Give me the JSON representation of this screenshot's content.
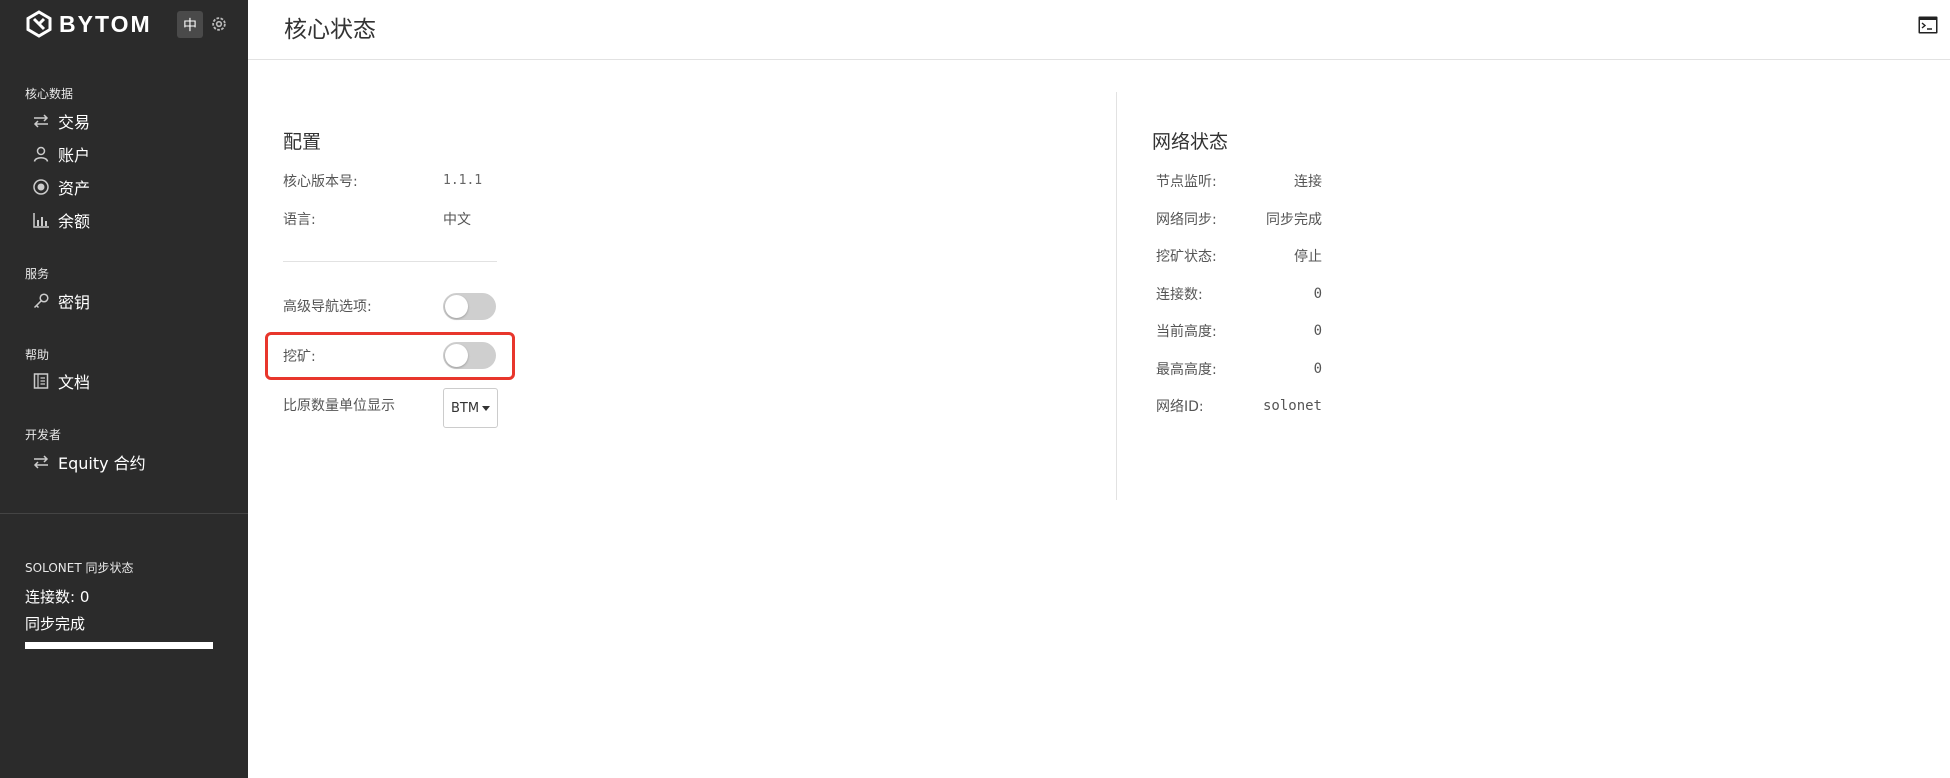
{
  "brand": {
    "name": "BYTOM"
  },
  "sidebar": {
    "lang_button": "中",
    "sections": [
      {
        "title": "核心数据",
        "items": [
          {
            "label": "交易",
            "icon": "transfer-icon"
          },
          {
            "label": "账户",
            "icon": "user-icon"
          },
          {
            "label": "资产",
            "icon": "asset-icon"
          },
          {
            "label": "余额",
            "icon": "balance-icon"
          }
        ]
      },
      {
        "title": "服务",
        "items": [
          {
            "label": "密钥",
            "icon": "key-icon"
          }
        ]
      },
      {
        "title": "帮助",
        "items": [
          {
            "label": "文档",
            "icon": "document-icon"
          }
        ]
      },
      {
        "title": "开发者",
        "items": [
          {
            "label": "Equity 合约",
            "icon": "transfer-icon"
          }
        ]
      }
    ],
    "sync": {
      "title": "SOLONET 同步状态",
      "peers": "连接数: 0",
      "state": "同步完成",
      "progress": 1.0
    }
  },
  "header": {
    "title": "核心状态",
    "console_icon": "terminal-icon"
  },
  "config": {
    "title": "配置",
    "core_version_label": "核心版本号:",
    "core_version_value": "1.1.1",
    "language_label": "语言:",
    "language_value": "中文",
    "advanced_nav_label": "高级导航选项:",
    "advanced_nav_on": false,
    "mining_label": "挖矿:",
    "mining_on": false,
    "unit_label": "比原数量单位显示",
    "unit_value": "BTM"
  },
  "network": {
    "title": "网络状态",
    "rows": [
      {
        "label": "节点监听:",
        "value": "连接",
        "mono": false
      },
      {
        "label": "网络同步:",
        "value": "同步完成",
        "mono": false
      },
      {
        "label": "挖矿状态:",
        "value": "停止",
        "mono": false
      },
      {
        "label": "连接数:",
        "value": "0",
        "mono": true
      },
      {
        "label": "当前高度:",
        "value": "0",
        "mono": true
      },
      {
        "label": "最高高度:",
        "value": "0",
        "mono": true
      },
      {
        "label": "网络ID:",
        "value": "solonet",
        "mono": true
      }
    ]
  },
  "colors": {
    "sidebar_bg": "#2b2b2b",
    "highlight": "#e8362c",
    "toggle_off": "#cfcfcf"
  }
}
